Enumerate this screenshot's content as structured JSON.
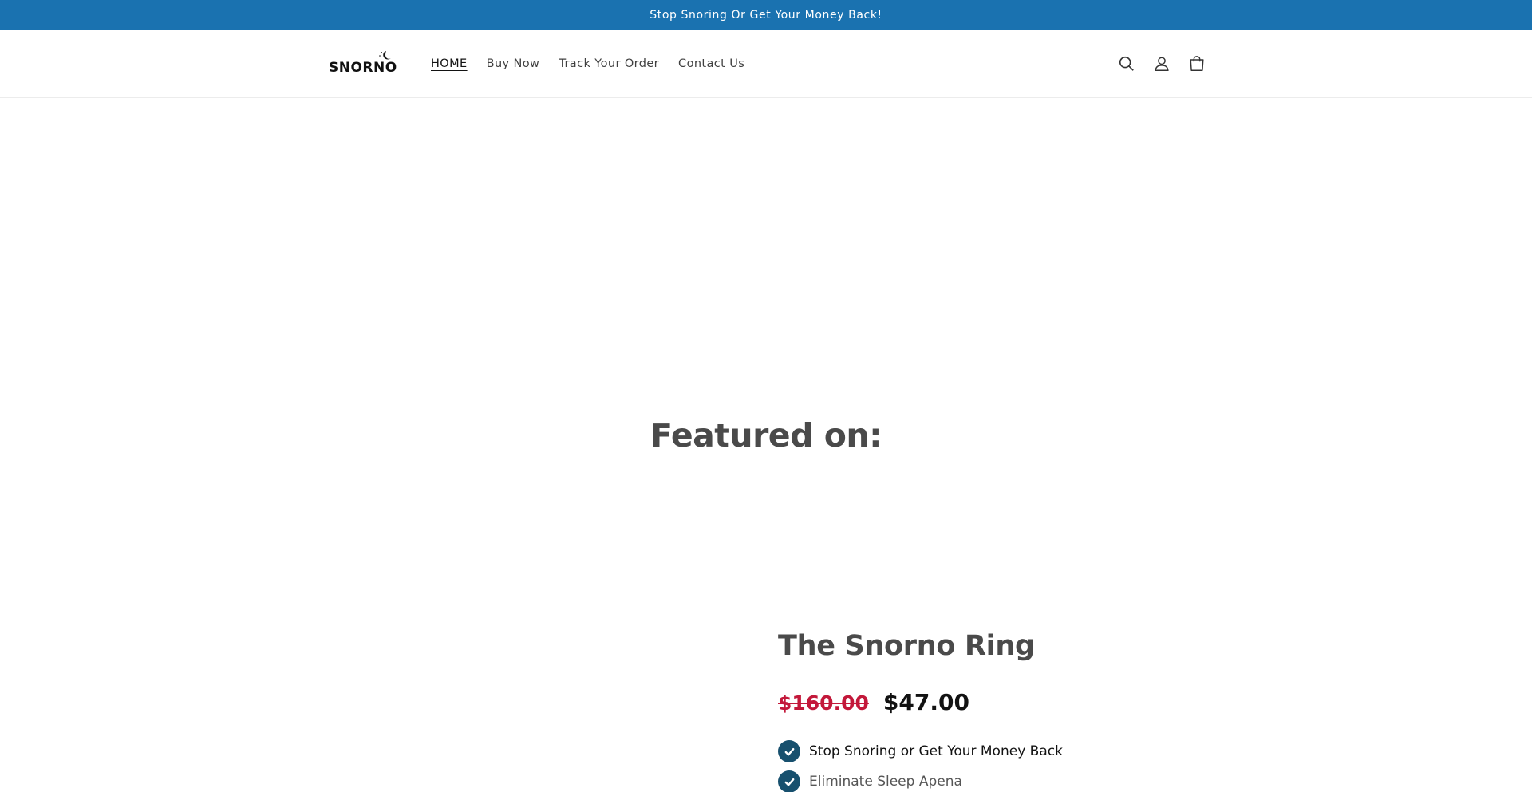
{
  "announcement": {
    "text": "Stop Snoring Or Get Your Money Back!"
  },
  "header": {
    "logo_text": "SNORNO",
    "nav": [
      {
        "label": "HOME",
        "active": true
      },
      {
        "label": "Buy Now"
      },
      {
        "label": "Track Your Order"
      },
      {
        "label": "Contact Us"
      }
    ],
    "icons": [
      "search-icon",
      "account-icon",
      "cart-icon"
    ]
  },
  "featured": {
    "heading": "Featured on:"
  },
  "product": {
    "title": "The Snorno Ring",
    "price_old": "$160.00",
    "price_new": "$47.00",
    "benefits": [
      "Stop Snoring or Get Your Money Back",
      "Eliminate Sleep Apena"
    ]
  },
  "colors": {
    "announcement_bg": "#1a72b0",
    "sale_price": "#c3183a",
    "check_badge": "#17506e"
  }
}
